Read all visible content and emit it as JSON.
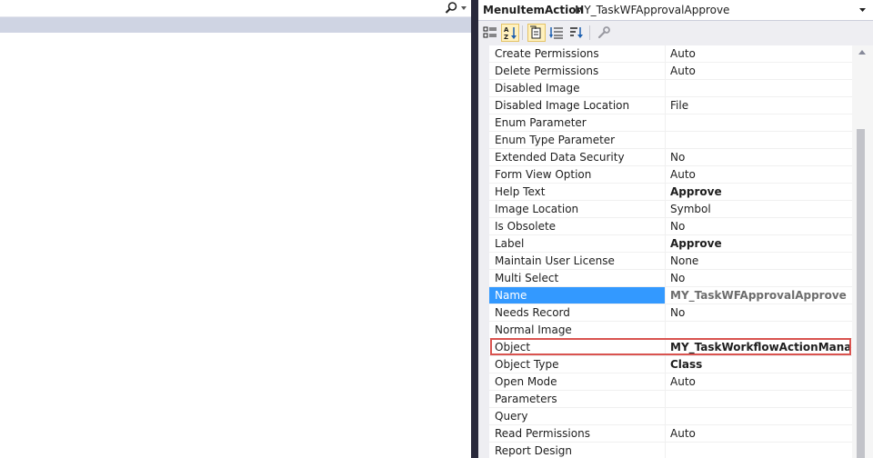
{
  "object_header": {
    "type": "MenuItemAction",
    "name": "MY_TaskWFApprovalApprove"
  },
  "toolbar": {
    "buttons": [
      {
        "id": "categorized",
        "icon": "categorized-icon"
      },
      {
        "id": "alphabetical",
        "icon": "alphabetical-sort-icon",
        "active": true
      },
      {
        "id": "property-pages",
        "icon": "property-pages-icon",
        "active": true
      },
      {
        "id": "events",
        "icon": "events-list-icon"
      },
      {
        "id": "sort",
        "icon": "sort-descending-icon"
      },
      {
        "id": "tools",
        "icon": "wrench-icon"
      }
    ]
  },
  "properties": [
    {
      "name": "Create Permissions",
      "value": "Auto"
    },
    {
      "name": "Delete Permissions",
      "value": "Auto"
    },
    {
      "name": "Disabled Image",
      "value": ""
    },
    {
      "name": "Disabled Image Location",
      "value": "File"
    },
    {
      "name": "Enum Parameter",
      "value": ""
    },
    {
      "name": "Enum Type Parameter",
      "value": ""
    },
    {
      "name": "Extended Data Security",
      "value": "No"
    },
    {
      "name": "Form View Option",
      "value": "Auto"
    },
    {
      "name": "Help Text",
      "value": "Approve",
      "bold": true
    },
    {
      "name": "Image Location",
      "value": "Symbol"
    },
    {
      "name": "Is Obsolete",
      "value": "No"
    },
    {
      "name": "Label",
      "value": "Approve",
      "bold": true
    },
    {
      "name": "Maintain User License",
      "value": "None"
    },
    {
      "name": "Multi Select",
      "value": "No"
    },
    {
      "name": "Name",
      "value": "MY_TaskWFApprovalApprove",
      "selected": true
    },
    {
      "name": "Needs Record",
      "value": "No"
    },
    {
      "name": "Normal Image",
      "value": ""
    },
    {
      "name": "Object",
      "value": "MY_TaskWorkflowActionManager",
      "bold": true,
      "highlighted": true
    },
    {
      "name": "Object Type",
      "value": "Class",
      "bold": true
    },
    {
      "name": "Open Mode",
      "value": "Auto"
    },
    {
      "name": "Parameters",
      "value": ""
    },
    {
      "name": "Query",
      "value": ""
    },
    {
      "name": "Read Permissions",
      "value": "Auto"
    },
    {
      "name": "Report Design",
      "value": ""
    }
  ],
  "colors": {
    "selection": "#3399ff",
    "highlight_border": "#d9534f",
    "splitter": "#29293b"
  }
}
